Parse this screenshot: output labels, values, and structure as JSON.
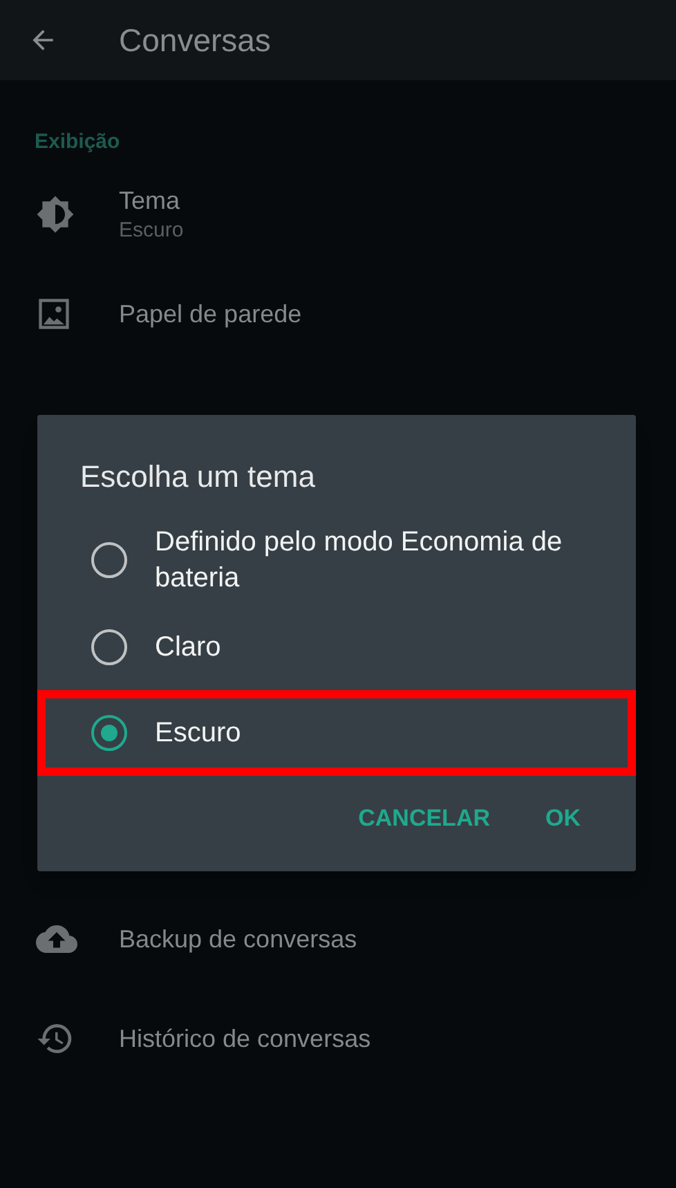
{
  "header": {
    "title": "Conversas"
  },
  "sections_above": [
    {
      "header": "Exibição",
      "items": [
        {
          "kind": "theme",
          "title": "Tema",
          "subtitle": "Escuro"
        },
        {
          "kind": "wallpaper",
          "title": "Papel de parede"
        }
      ]
    }
  ],
  "items_below": [
    {
      "kind": "backup",
      "title": "Backup de conversas"
    },
    {
      "kind": "history",
      "title": "Histórico de conversas"
    }
  ],
  "dialog": {
    "title": "Escolha um tema",
    "options": [
      {
        "label": "Definido pelo modo Economia de bateria",
        "selected": false,
        "highlighted": false
      },
      {
        "label": "Claro",
        "selected": false,
        "highlighted": false
      },
      {
        "label": "Escuro",
        "selected": true,
        "highlighted": true
      }
    ],
    "buttons": [
      "CANCELAR",
      "OK"
    ]
  }
}
